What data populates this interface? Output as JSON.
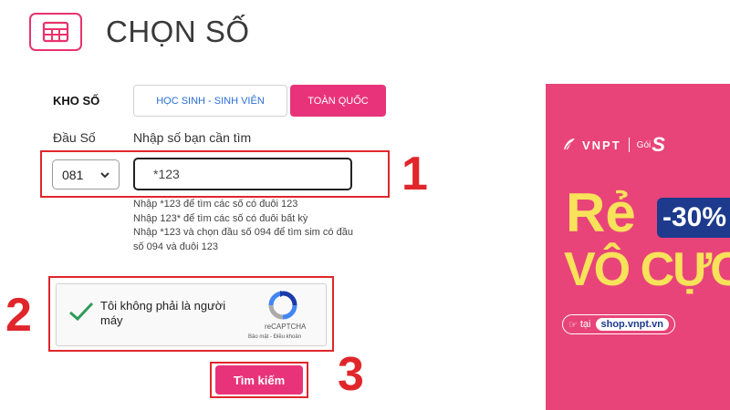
{
  "header": {
    "title": "CHỌN SỐ",
    "icon": "sim-card-icon"
  },
  "kho_so": {
    "label": "KHO SỐ",
    "tabs": [
      {
        "label": "HỌC SINH - SINH VIÊN",
        "active": false
      },
      {
        "label": "TOÀN QUỐC",
        "active": true
      }
    ]
  },
  "form": {
    "prefix_label": "Đầu Số",
    "prefix_value": "081",
    "number_label": "Nhập số bạn cần tìm",
    "number_value": "*123",
    "hints": [
      "Nhập *123 để tìm các số có đuôi 123",
      "Nhập 123* để tìm các số có đuôi bất kỳ",
      "Nhập *123 và chọn đầu số 094 để tìm sim có đầu số 094 và đuôi 123"
    ]
  },
  "captcha": {
    "text": "Tôi không phải là người máy",
    "brand": "reCAPTCHA",
    "links": "Bảo mật - Điều khoản"
  },
  "search_button": {
    "label": "Tìm kiếm"
  },
  "annotations": {
    "one": "1",
    "two": "2",
    "three": "3"
  },
  "banner": {
    "brand": "VNPT",
    "package": "Gói",
    "package_mark": "S",
    "headline_1": "Rẻ",
    "discount": "-30%",
    "headline_2": "VÔ CỰC",
    "shop_prefix": "tại",
    "shop_url": "shop.vnpt.vn"
  },
  "colors": {
    "accent": "#e8337a",
    "annotation_red": "#e0262b",
    "link_blue": "#2a6fd6",
    "banner_bg": "#e8447a",
    "banner_yellow": "#f7e25a",
    "banner_navy": "#1d3a8c",
    "check_green": "#2e9c57"
  }
}
